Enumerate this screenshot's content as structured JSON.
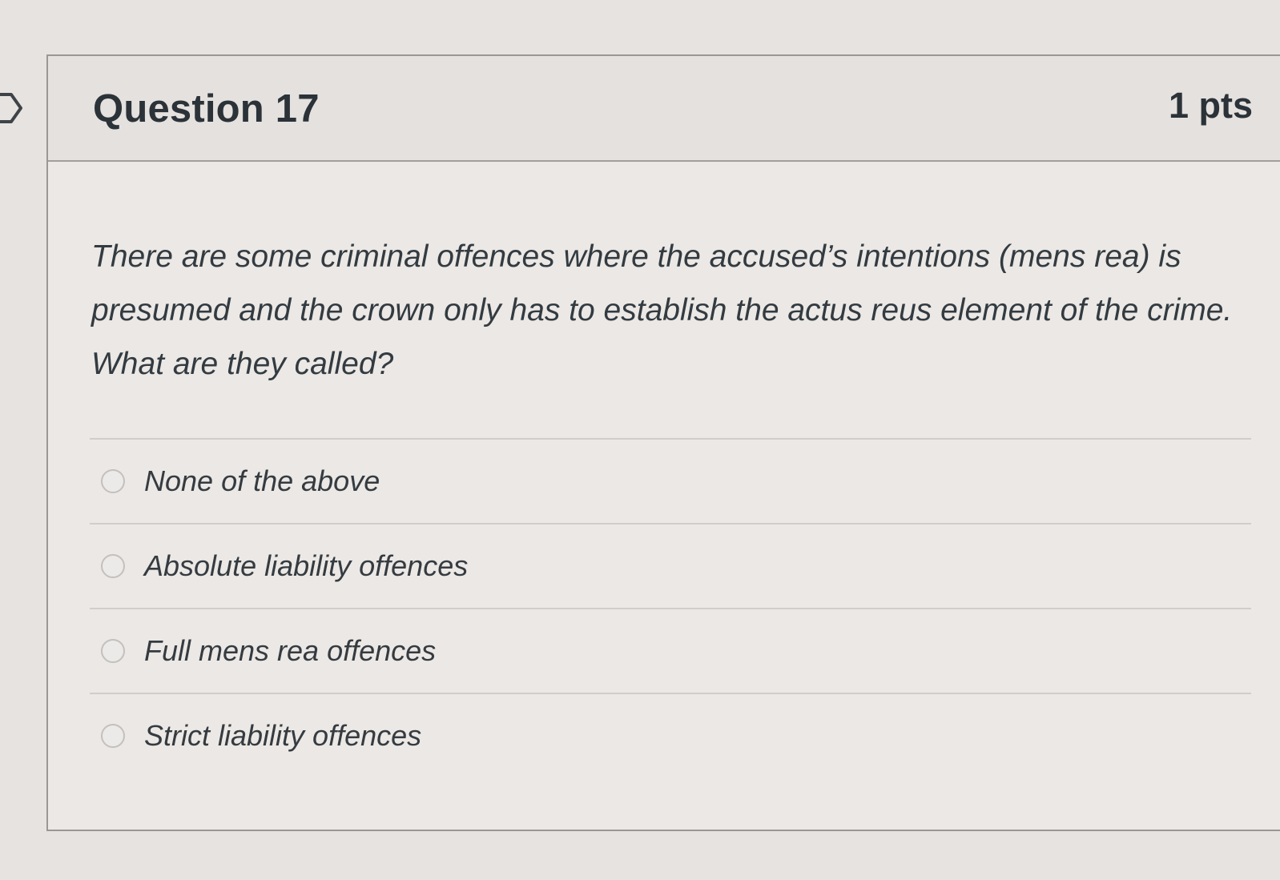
{
  "question": {
    "title": "Question 17",
    "points": "1 pts",
    "text": "There are some criminal offences where the accused’s intentions (mens rea) is presumed and the crown only has to establish the actus reus element of the crime. What are they called?"
  },
  "answers": [
    {
      "label": "None of the above",
      "selected": false
    },
    {
      "label": "Absolute liability offences",
      "selected": false
    },
    {
      "label": "Full mens rea offences",
      "selected": false
    },
    {
      "label": "Strict liability offences",
      "selected": false
    }
  ],
  "icons": {
    "flag": "flag-icon",
    "radio": "radio-unselected-icon"
  },
  "colors": {
    "background": "#e6e3e0",
    "border": "#9a9795",
    "text": "#2d3b45"
  }
}
